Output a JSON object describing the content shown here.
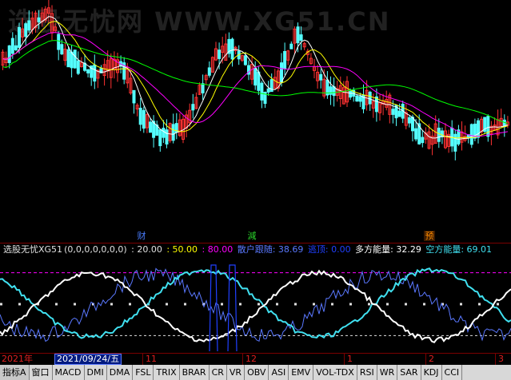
{
  "watermark": "选股无忧网 WWW.XG51.CN",
  "colors": {
    "up": "#ff3232",
    "down": "#54ffff",
    "ma5": "#ffffff",
    "ma10": "#ffff00",
    "ma20": "#ff00ff",
    "ma60": "#00ff00"
  },
  "news_marks": [
    {
      "label": "财",
      "color": "#4a7dff"
    },
    {
      "label": "減",
      "color": "#2ad02a"
    },
    {
      "label": "预",
      "color": "#ff8c00"
    }
  ],
  "indicator": {
    "name": "选股无忧XG51",
    "params": "(0,0,0,0,0,0,0)",
    "levels": [
      {
        "label": ": 20.00",
        "color": "#e0e0e0"
      },
      {
        "label": ": 50.00",
        "color": "#ffff00"
      },
      {
        "label": ": 80.00",
        "color": "#ff00ff"
      }
    ],
    "series": [
      {
        "label": "散户跟随: 38.69",
        "color": "#5a78ff"
      },
      {
        "label": "逃顶: 0.00",
        "color": "#2040ff"
      },
      {
        "label": "多方能量: 32.29",
        "color": "#ffffff"
      },
      {
        "label": "空方能量: 69.01",
        "color": "#40e0f0"
      }
    ]
  },
  "date_axis": {
    "year_label": "2021年",
    "cursor_date": "2021/09/24/五",
    "month_labels": [
      "11",
      "12",
      "1",
      "2",
      "3"
    ]
  },
  "tabs": [
    "指标A",
    "窗口",
    "MACD",
    "DMI",
    "DMA",
    "FSL",
    "TRIX",
    "BRAR",
    "CR",
    "VR",
    "OBV",
    "ASI",
    "EMV",
    "VOL-TDX",
    "RSI",
    "WR",
    "SAR",
    "KDJ",
    "CCI"
  ]
}
